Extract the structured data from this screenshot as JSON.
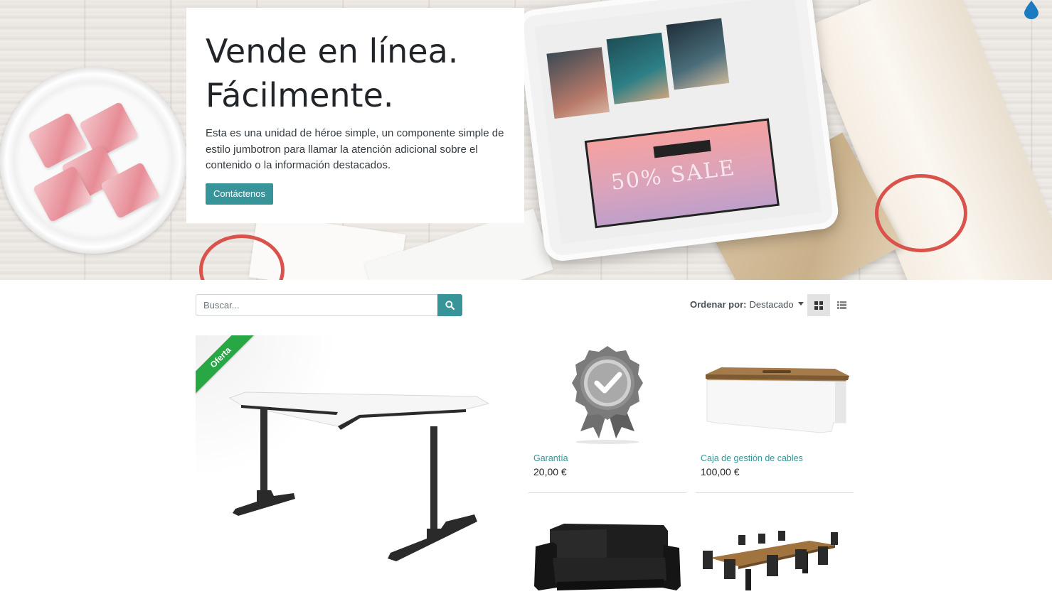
{
  "hero": {
    "title_line1": "Vende en línea.",
    "title_line2": "Fácilmente.",
    "text": "Esta es una unidad de héroe simple, un componente simple de estilo jumbotron para llamar la atención adicional sobre el contenido o la información destacados.",
    "button_label": "Contáctenos",
    "tablet_banner_text": "50% SALE"
  },
  "toolbar": {
    "search_placeholder": "Buscar...",
    "sort_label": "Ordenar por:",
    "sort_value": "Destacado"
  },
  "products": {
    "featured": {
      "ribbon": "Oferta"
    },
    "items": [
      {
        "name": "Garantía",
        "price": "20,00 €"
      },
      {
        "name": "Caja de gestión de cables",
        "price": "100,00 €"
      }
    ]
  },
  "colors": {
    "accent": "#37959a",
    "sale_ribbon": "#28a745",
    "droplet": "#1a7bc0"
  },
  "icons": [
    "droplet-icon",
    "search-icon",
    "grid-view-icon",
    "list-view-icon",
    "caret-down-icon"
  ]
}
